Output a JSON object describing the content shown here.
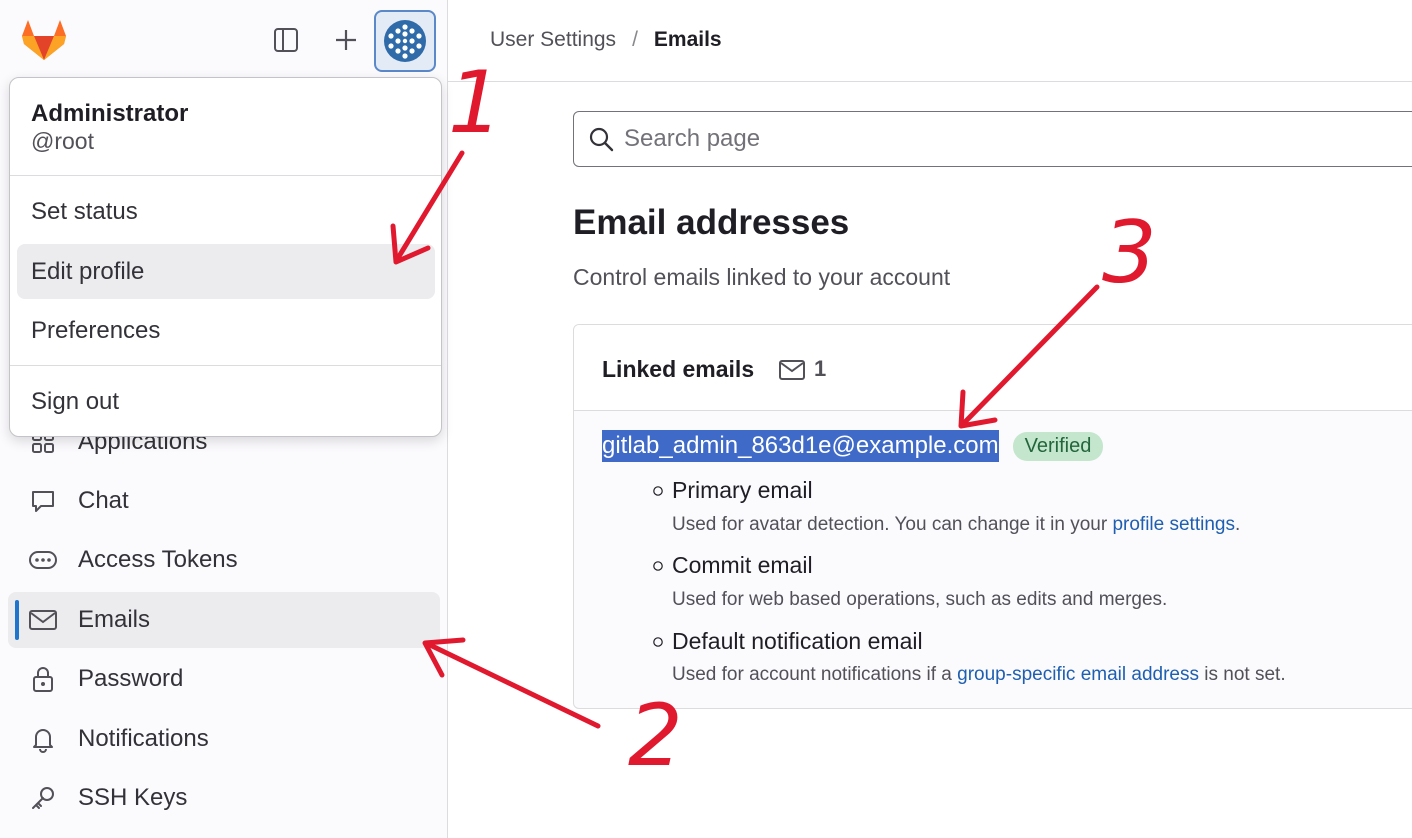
{
  "sidebar": {
    "logo_icon": "gitlab-tanuki-icon",
    "toggle_icon": "sidebar-toggle-icon",
    "new_icon": "plus-icon",
    "avatar_icon": "user-avatar-icon",
    "items": [
      {
        "label": "Applications",
        "icon": "applications-icon"
      },
      {
        "label": "Chat",
        "icon": "chat-icon"
      },
      {
        "label": "Access Tokens",
        "icon": "token-icon"
      },
      {
        "label": "Emails",
        "icon": "mail-icon",
        "active": true
      },
      {
        "label": "Password",
        "icon": "lock-icon"
      },
      {
        "label": "Notifications",
        "icon": "bell-icon"
      },
      {
        "label": "SSH Keys",
        "icon": "key-icon"
      }
    ]
  },
  "user_menu": {
    "name": "Administrator",
    "handle": "@root",
    "items": [
      "Set status",
      "Edit profile",
      "Preferences",
      "Sign out"
    ]
  },
  "breadcrumb": {
    "parent": "User Settings",
    "separator": "/",
    "current": "Emails"
  },
  "search": {
    "placeholder": "Search page"
  },
  "section": {
    "title": "Email addresses",
    "subtitle": "Control emails linked to your account"
  },
  "card": {
    "title": "Linked emails",
    "count": "1",
    "email": "gitlab_admin_863d1e@example.com",
    "badge": "Verified",
    "bullets": [
      {
        "title": "Primary email",
        "desc_before": "Used for avatar detection. You can change it in your ",
        "link": "profile settings",
        "desc_after": "."
      },
      {
        "title": "Commit email",
        "desc_before": "Used for web based operations, such as edits and merges.",
        "link": "",
        "desc_after": ""
      },
      {
        "title": "Default notification email",
        "desc_before": "Used for account notifications if a ",
        "link": "group-specific email address",
        "desc_after": " is not set."
      }
    ]
  },
  "annotations": {
    "labels": [
      "1",
      "2",
      "3"
    ],
    "color": "#e0192e"
  }
}
